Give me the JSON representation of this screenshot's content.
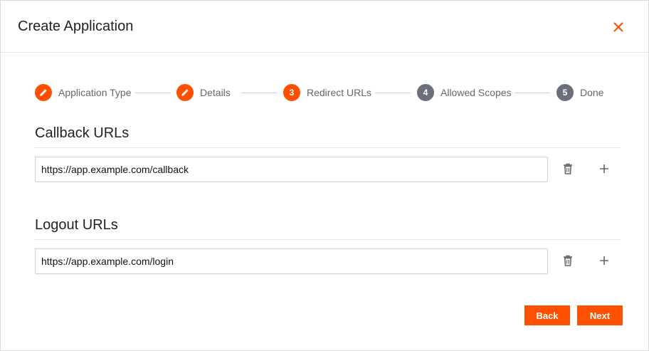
{
  "dialog": {
    "title": "Create Application",
    "accent_color": "#ff4f00",
    "inactive_step_color": "#6b6f7b"
  },
  "stepper": {
    "steps": [
      {
        "label": "Application Type",
        "state": "completed",
        "icon": "pencil-icon"
      },
      {
        "label": "Details",
        "state": "completed",
        "icon": "pencil-icon"
      },
      {
        "label": "Redirect URLs",
        "state": "active",
        "number": "3"
      },
      {
        "label": "Allowed Scopes",
        "state": "pending",
        "number": "4"
      },
      {
        "label": "Done",
        "state": "pending",
        "number": "5"
      }
    ]
  },
  "callback": {
    "title": "Callback URLs",
    "value": "https://app.example.com/callback"
  },
  "logout": {
    "title": "Logout URLs",
    "value": "https://app.example.com/login"
  },
  "footer": {
    "back_label": "Back",
    "next_label": "Next"
  }
}
